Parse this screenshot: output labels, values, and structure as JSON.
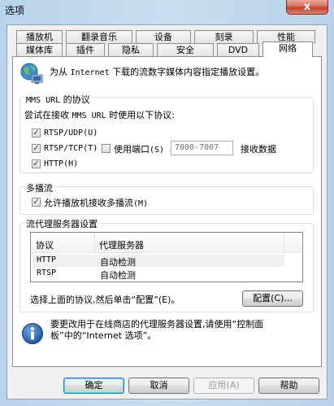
{
  "window": {
    "title": "选项",
    "close_glyph": "x"
  },
  "tabs_row_back": [
    "播放机",
    "翻录音乐",
    "设备",
    "刻录",
    "性能"
  ],
  "tabs_row_front": [
    "媒体库",
    "插件",
    "隐私",
    "安全",
    "DVD",
    "网络"
  ],
  "active_tab": "网络",
  "intro": {
    "prefix": "为从",
    "app": "Internet",
    "suffix": "下载的流数字媒体内容指定播放设置。"
  },
  "protocols": {
    "title_prefix": "MMS URL",
    "title_suffix": "的协议",
    "desc_prefix": "尝试在接收",
    "desc_mms": "MMS URL",
    "desc_suffix": "时使用以下协议:",
    "rtsp_udp": {
      "label": "RTSP/UDP",
      "key": "(U)",
      "checked": true
    },
    "rtsp_tcp": {
      "label": "RTSP/TCP",
      "key": "(T)",
      "checked": true
    },
    "use_port": {
      "label": "使用端口",
      "key": "(S)",
      "checked": false
    },
    "port_range": "7000-7007",
    "receive_label": "接收数据",
    "http": {
      "label": "HTTP",
      "key": "(H)",
      "checked": true
    }
  },
  "multicast": {
    "title": "多播流",
    "allow": {
      "label": "允许播放机接收多播流",
      "key": "(M)",
      "checked": true
    }
  },
  "proxy": {
    "title": "流代理服务器设置",
    "headers": [
      "协议",
      "代理服务器"
    ],
    "rows": [
      [
        "HTTP",
        "自动检测"
      ],
      [
        "RTSP",
        "自动检测"
      ]
    ],
    "hint": "选择上面的协议,然后单击“配置”(E)。",
    "configure_button": "配置(C)..."
  },
  "info": {
    "line1": "要更改用于在线商店的代理服务器设置,请使用“控制面",
    "line2": "板”中的“Internet 选项”。"
  },
  "buttons": {
    "ok": "确定",
    "cancel": "取消",
    "apply": "应用(A)",
    "help": "帮助"
  },
  "colors": {
    "accent": "#1e5fa8",
    "check": "#1c3c6e",
    "close": "#c9452f"
  }
}
